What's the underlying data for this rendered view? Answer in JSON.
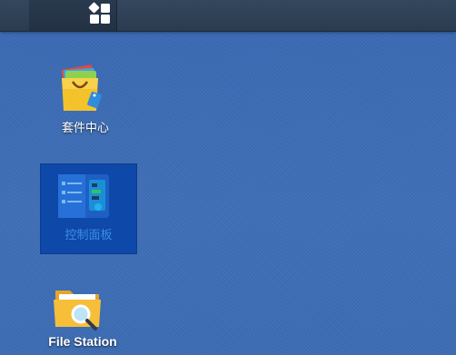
{
  "taskbar": {
    "main_menu_icon": "grid-app-icon"
  },
  "desktop": {
    "icons": [
      {
        "label": "套件中心",
        "icon": "package-center-icon",
        "selected": false
      },
      {
        "label": "控制面板",
        "icon": "control-panel-icon",
        "selected": true
      },
      {
        "label": "File Station",
        "icon": "file-station-icon",
        "selected": false
      }
    ]
  },
  "colors": {
    "desktop_background": "#3d6db5",
    "taskbar": "#2f4258",
    "selection": "#0e48a8",
    "selected_label": "#3b8ee8"
  }
}
